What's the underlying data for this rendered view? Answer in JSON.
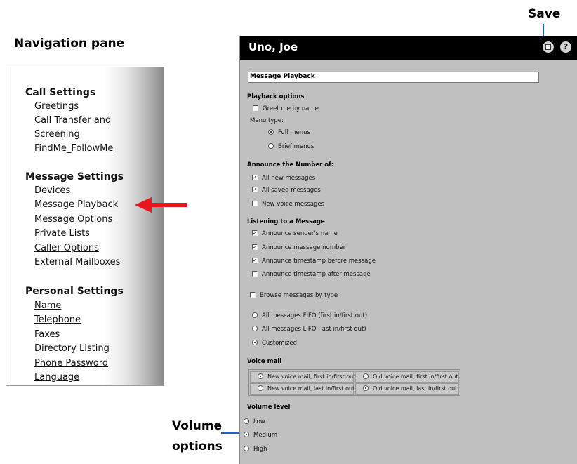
{
  "callouts": {
    "save": "Save",
    "navigation_pane": "Navigation pane",
    "volume_line1": "Volume",
    "volume_line2": "options"
  },
  "nav": {
    "groups": [
      {
        "heading": "Call Settings",
        "items": [
          "Greetings",
          "Call Transfer and",
          "Screening",
          "FindMe_FollowMe"
        ]
      },
      {
        "heading": "Message Settings",
        "items": [
          "Devices",
          "Message Playback",
          "Message Options",
          "Private Lists",
          "Caller Options",
          "External Mailboxes"
        ]
      },
      {
        "heading": "Personal Settings",
        "items": [
          "Name",
          "Telephone",
          "Faxes",
          "Directory Listing",
          "Phone Password",
          "Language"
        ]
      }
    ]
  },
  "app": {
    "user_name": "Uno, Joe",
    "help_icon": "?",
    "page_title": "Message Playback",
    "playback_options": {
      "heading": "Playback options",
      "greet": "Greet me by name",
      "greet_checked": false,
      "menu_type_label": "Menu type:",
      "full_menus": "Full menus",
      "brief_menus": "Brief menus",
      "menu_selected": "Full menus"
    },
    "announce": {
      "heading": "Announce the Number of:",
      "items": [
        {
          "label": "All new messages",
          "checked": true
        },
        {
          "label": "All saved messages",
          "checked": true
        },
        {
          "label": "New voice messages",
          "checked": false
        }
      ]
    },
    "listening": {
      "heading": "Listening to a Message",
      "items": [
        {
          "label": "Announce sender's name",
          "checked": true
        },
        {
          "label": "Announce message number",
          "checked": true
        },
        {
          "label": "Announce timestamp before message",
          "checked": true
        },
        {
          "label": "Announce timestamp after message",
          "checked": false
        }
      ]
    },
    "browse": {
      "label": "Browse messages by type",
      "checked": false
    },
    "order": {
      "options": [
        "All messages FIFO (first in/first out)",
        "All messages LIFO (last in/first out)",
        "Customized"
      ],
      "selected": "Customized"
    },
    "voice_mail": {
      "heading": "Voice mail",
      "options": [
        "New voice mail, first in/first out",
        "Old voice mail, first in/first out",
        "New voice mail, last in/first out",
        "Old voice mail, last in/first out"
      ],
      "selected_new": "New voice mail, first in/first out",
      "selected_old": "Old voice mail, last in/first out"
    },
    "volume": {
      "heading": "Volume level",
      "options": [
        "Low",
        "Medium",
        "High"
      ],
      "selected": "Medium"
    }
  },
  "colors": {
    "arrow": "#e8171e",
    "callout_line": "#1f5fd0",
    "app_background": "#c0c0c0",
    "app_header": "#000000"
  }
}
